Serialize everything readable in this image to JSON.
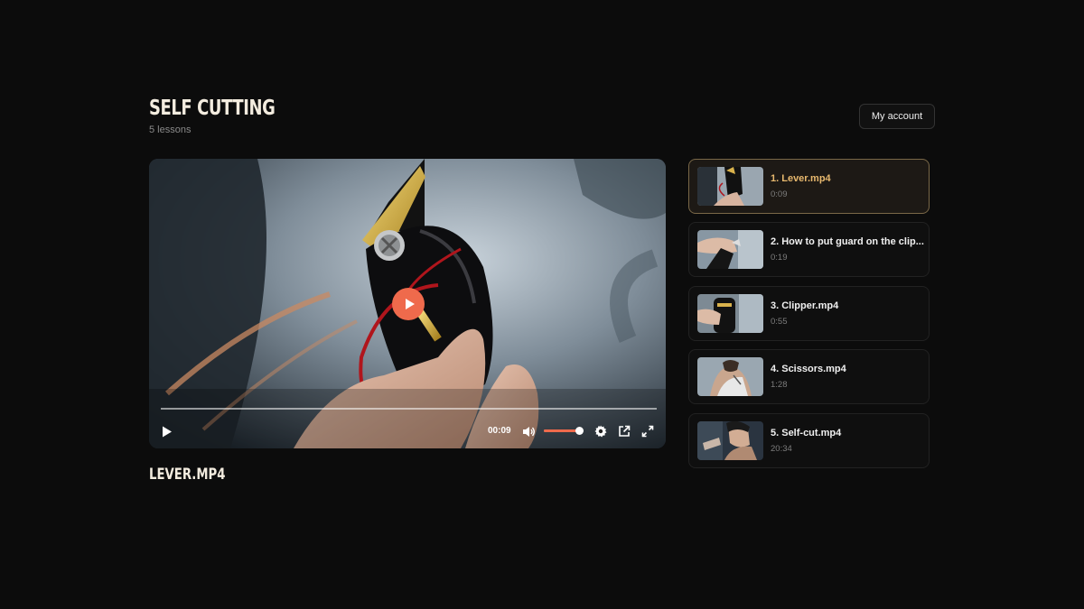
{
  "course": {
    "title": "SELF CUTTING",
    "subtitle": "5 lessons"
  },
  "header": {
    "account_label": "My account"
  },
  "player": {
    "current_time": "00:09",
    "progress_fraction": 0.0,
    "volume_fraction": 0.95,
    "controls": [
      "play-icon",
      "volume-icon",
      "settings-icon",
      "external-link-icon",
      "fullscreen-icon"
    ],
    "accent_color": "#ef6a4c"
  },
  "now_playing": {
    "title": "LEVER.MP4"
  },
  "lessons": [
    {
      "title": "1. Lever.mp4",
      "duration": "0:09",
      "active": true
    },
    {
      "title": "2. How to put guard on the clip...",
      "duration": "0:19",
      "active": false
    },
    {
      "title": "3. Clipper.mp4",
      "duration": "0:55",
      "active": false
    },
    {
      "title": "4. Scissors.mp4",
      "duration": "1:28",
      "active": false
    },
    {
      "title": "5. Self-cut.mp4",
      "duration": "20:34",
      "active": false
    }
  ],
  "colors": {
    "background": "#0c0c0c",
    "active_title": "#e7b86e",
    "active_border": "#7a6848",
    "heading": "#f3ecdf"
  }
}
